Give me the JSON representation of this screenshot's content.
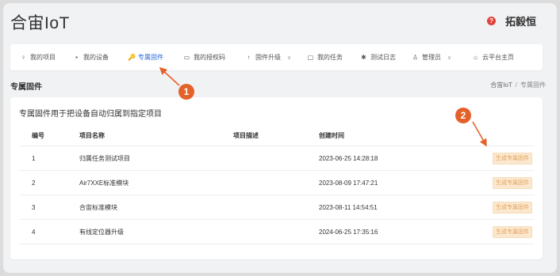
{
  "brand": "合宙IoT",
  "user": {
    "name": "拓毅恒"
  },
  "nav": [
    {
      "icon": "♀",
      "label": "我的项目",
      "chevron": false
    },
    {
      "icon": "▪",
      "label": "我的设备",
      "chevron": false
    },
    {
      "icon": "🔑",
      "label": "专属固件",
      "chevron": false
    },
    {
      "icon": "▭",
      "label": "我的授权码",
      "chevron": false
    },
    {
      "icon": "↑",
      "label": "固件升级",
      "chevron": true
    },
    {
      "icon": "▢",
      "label": "我的任务",
      "chevron": false
    },
    {
      "icon": "✱",
      "label": "测试日志",
      "chevron": false
    },
    {
      "icon": "♙",
      "label": "管理员",
      "chevron": true
    },
    {
      "icon": "⌂",
      "label": "云平台主页",
      "chevron": false
    }
  ],
  "page": {
    "title": "专属固件"
  },
  "breadcrumb": {
    "home": "合宙IoT",
    "sep": "/",
    "current": "专属固件"
  },
  "card": {
    "title": "专属固件用于把设备自动归属到指定项目"
  },
  "table": {
    "headers": [
      "编号",
      "项目名称",
      "项目描述",
      "创建时间"
    ],
    "rows": [
      {
        "id": "1",
        "name": "归属任务测试项目",
        "desc": "",
        "created": "2023-06-25 14:28:18",
        "action": "生成专属固件"
      },
      {
        "id": "2",
        "name": "Air7XXE标准模块",
        "desc": "",
        "created": "2023-08-09 17:47:21",
        "action": "生成专属固件"
      },
      {
        "id": "3",
        "name": "合宙标准模块",
        "desc": "",
        "created": "2023-08-11 14:54:51",
        "action": "生成专属固件"
      },
      {
        "id": "4",
        "name": "有线定位器升级",
        "desc": "",
        "created": "2024-06-25 17:35:16",
        "action": "生成专属固件"
      }
    ]
  },
  "annotations": [
    {
      "label": "1"
    },
    {
      "label": "2"
    }
  ],
  "colors": {
    "accent": "#2f6bd8",
    "marker": "#e4622a",
    "gen_button_bg": "#fbe8cf",
    "gen_button_text": "#e3a35e"
  }
}
